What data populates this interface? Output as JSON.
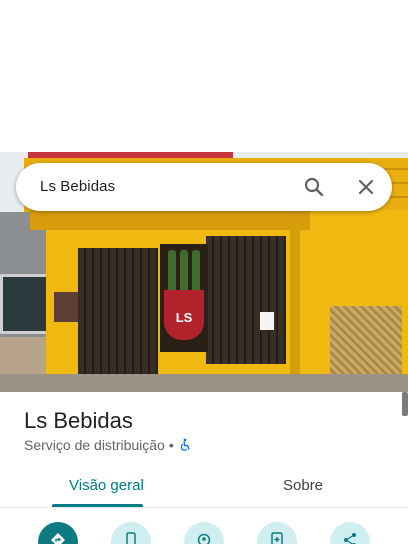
{
  "search": {
    "query": "Ls Bebidas"
  },
  "place": {
    "name": "Ls Bebidas",
    "category": "Serviço de distribuição",
    "separator": "•"
  },
  "tabs": [
    {
      "label": "Visão geral",
      "selected": true
    },
    {
      "label": "Sobre",
      "selected": false
    }
  ],
  "photo": {
    "poster_text": "LS"
  },
  "actions": [
    {
      "icon": "directions-icon",
      "primary": true
    },
    {
      "icon": "phone-icon",
      "primary": false
    },
    {
      "icon": "nearby-icon",
      "primary": false
    },
    {
      "icon": "save-icon",
      "primary": false
    },
    {
      "icon": "share-icon",
      "primary": false
    }
  ],
  "colors": {
    "accent": "#007b83",
    "action_bg": "#cfeef0",
    "primary_action": "#0e7b83"
  }
}
